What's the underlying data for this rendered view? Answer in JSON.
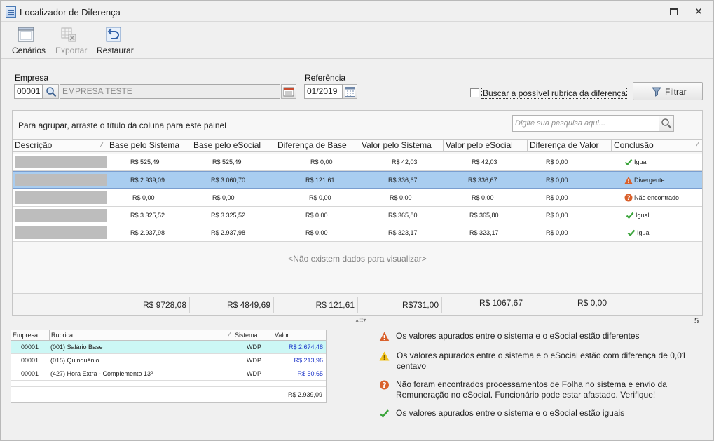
{
  "window": {
    "title": "Localizador de Diferença"
  },
  "toolbar": {
    "scenarios": "Cenários",
    "export": "Exportar",
    "restore": "Restaurar"
  },
  "filters": {
    "company_label": "Empresa",
    "company_code": "00001",
    "company_name": "EMPRESA TESTE",
    "reference_label": "Referência",
    "reference_value": "01/2019",
    "checkbox_label": "Buscar a possível rubrica da diferença",
    "checkbox_checked": false,
    "filter_button": "Filtrar"
  },
  "grid": {
    "group_hint": "Para agrupar, arraste o título da coluna para este painel",
    "search_placeholder": "Digite sua pesquisa aqui...",
    "columns": [
      "Descrição",
      "Base pelo Sistema",
      "Base pelo eSocial",
      "Diferença de Base",
      "Valor pelo Sistema",
      "Valor pelo eSocial",
      "Diferença de Valor",
      "Conclusão"
    ],
    "rows": [
      {
        "base_sis": "R$ 525,49",
        "base_esoc": "R$ 525,49",
        "dif_base": "R$ 0,00",
        "val_sis": "R$ 42,03",
        "val_esoc": "R$ 42,03",
        "dif_val": "R$ 0,00",
        "conclusion": "Igual",
        "status": "equal"
      },
      {
        "base_sis": "R$ 2.939,09",
        "base_esoc": "R$ 3.060,70",
        "dif_base": "R$ 121,61",
        "val_sis": "R$ 336,67",
        "val_esoc": "R$ 336,67",
        "dif_val": "R$ 0,00",
        "conclusion": "Divergente",
        "status": "divergent"
      },
      {
        "base_sis": "R$ 0,00",
        "base_esoc": "R$ 0,00",
        "dif_base": "R$ 0,00",
        "val_sis": "R$ 0,00",
        "val_esoc": "R$ 0,00",
        "dif_val": "R$ 0,00",
        "conclusion": "Não encontrado",
        "status": "not-found"
      },
      {
        "base_sis": "R$ 3.325,52",
        "base_esoc": "R$ 3.325,52",
        "dif_base": "R$ 0,00",
        "val_sis": "R$ 365,80",
        "val_esoc": "R$ 365,80",
        "dif_val": "R$ 0,00",
        "conclusion": "Igual",
        "status": "equal"
      },
      {
        "base_sis": "R$ 2.937,98",
        "base_esoc": "R$ 2.937,98",
        "dif_base": "R$ 0,00",
        "val_sis": "R$ 323,17",
        "val_esoc": "R$ 323,17",
        "dif_val": "R$ 0,00",
        "conclusion": "Igual",
        "status": "equal"
      }
    ],
    "empty_message": "<Não existem dados para visualizar>",
    "totals": {
      "base_sis": "R$ 9728,08",
      "base_esoc": "R$ 4849,69",
      "dif_base": "R$ 121,61",
      "val_sis": "R$731,00",
      "val_esoc": "R$ 1067,67",
      "dif_val": "R$ 0,00"
    },
    "record_count": "5"
  },
  "rubrics": {
    "columns": [
      "Empresa",
      "Rubrica",
      "Sistema",
      "Valor"
    ],
    "rows": [
      {
        "company": "00001",
        "rubric": "(001) Salário Base",
        "system": "WDP",
        "value": "R$ 2.674,48"
      },
      {
        "company": "00001",
        "rubric": "(015) Quinquênio",
        "system": "WDP",
        "value": "R$ 213,96"
      },
      {
        "company": "00001",
        "rubric": "(427) Hora Extra - Complemento 13º",
        "system": "WDP",
        "value": "R$ 50,65"
      }
    ],
    "total": "R$ 2.939,09"
  },
  "legend": {
    "divergent": "Os valores apurados entre o sistema e o eSocial estão diferentes",
    "warning": "Os valores apurados entre o sistema e o eSocial estão com diferença de 0,01 centavo",
    "not_found": "Não foram encontrados processamentos de Folha no sistema e envio da Remuneração no eSocial. Funcionário pode estar afastado. Verifique!",
    "equal": "Os valores apurados entre o sistema e o eSocial estão iguais"
  },
  "colors": {
    "selected_row": "#a9cdf0",
    "selected_subrow": "#ccf7f5",
    "value_blue": "#1d36c9",
    "check_green": "#3aa43a",
    "warn_orange": "#d9602b",
    "warn_yellow": "#f2c21a"
  },
  "icons": {
    "equal": "check-icon",
    "divergent": "warning-triangle-icon",
    "warning": "warning-yellow-icon",
    "not_found": "question-icon"
  }
}
